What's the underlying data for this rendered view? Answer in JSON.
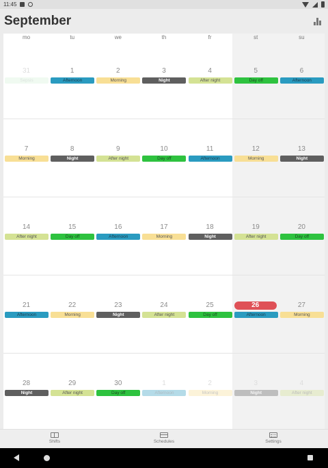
{
  "statusbar": {
    "time": "11:45"
  },
  "appbar": {
    "title": "September"
  },
  "weekdays": [
    "mo",
    "tu",
    "we",
    "th",
    "fr",
    "st",
    "su"
  ],
  "colors": {
    "Morning": "#f8df95",
    "Afternoon": "#2a9bc0",
    "Night": "#5f5f5f",
    "After night": "#d4e294",
    "Day off": "#2ec23f",
    "Sepsis": "#d7f2da",
    "today": "#df5157"
  },
  "weeks": [
    [
      {
        "day": "31",
        "shift": "Sepsis",
        "faded": true
      },
      {
        "day": "1",
        "shift": "Afternoon"
      },
      {
        "day": "2",
        "shift": "Morning"
      },
      {
        "day": "3",
        "shift": "Night"
      },
      {
        "day": "4",
        "shift": "After night"
      },
      {
        "day": "5",
        "shift": "Day off"
      },
      {
        "day": "6",
        "shift": "Afternoon"
      }
    ],
    [
      {
        "day": "7",
        "shift": "Morning"
      },
      {
        "day": "8",
        "shift": "Night"
      },
      {
        "day": "9",
        "shift": "After night"
      },
      {
        "day": "10",
        "shift": "Day off"
      },
      {
        "day": "11",
        "shift": "Afternoon"
      },
      {
        "day": "12",
        "shift": "Morning"
      },
      {
        "day": "13",
        "shift": "Night"
      }
    ],
    [
      {
        "day": "14",
        "shift": "After night"
      },
      {
        "day": "15",
        "shift": "Day off"
      },
      {
        "day": "16",
        "shift": "Afternoon"
      },
      {
        "day": "17",
        "shift": "Morning"
      },
      {
        "day": "18",
        "shift": "Night"
      },
      {
        "day": "19",
        "shift": "After night"
      },
      {
        "day": "20",
        "shift": "Day off"
      }
    ],
    [
      {
        "day": "21",
        "shift": "Afternoon"
      },
      {
        "day": "22",
        "shift": "Morning"
      },
      {
        "day": "23",
        "shift": "Night"
      },
      {
        "day": "24",
        "shift": "After night"
      },
      {
        "day": "25",
        "shift": "Day off"
      },
      {
        "day": "26",
        "shift": "Afternoon",
        "today": true
      },
      {
        "day": "27",
        "shift": "Morning"
      }
    ],
    [
      {
        "day": "28",
        "shift": "Night"
      },
      {
        "day": "29",
        "shift": "After night"
      },
      {
        "day": "30",
        "shift": "Day off"
      },
      {
        "day": "1",
        "shift": "Afternoon",
        "faded": true
      },
      {
        "day": "2",
        "shift": "Morning",
        "faded": true
      },
      {
        "day": "3",
        "shift": "Night",
        "faded": true
      },
      {
        "day": "4",
        "shift": "After night",
        "faded": true
      }
    ]
  ],
  "bottomnav": {
    "shifts": "Shifts",
    "schedules": "Schedules",
    "settings": "Settings"
  }
}
